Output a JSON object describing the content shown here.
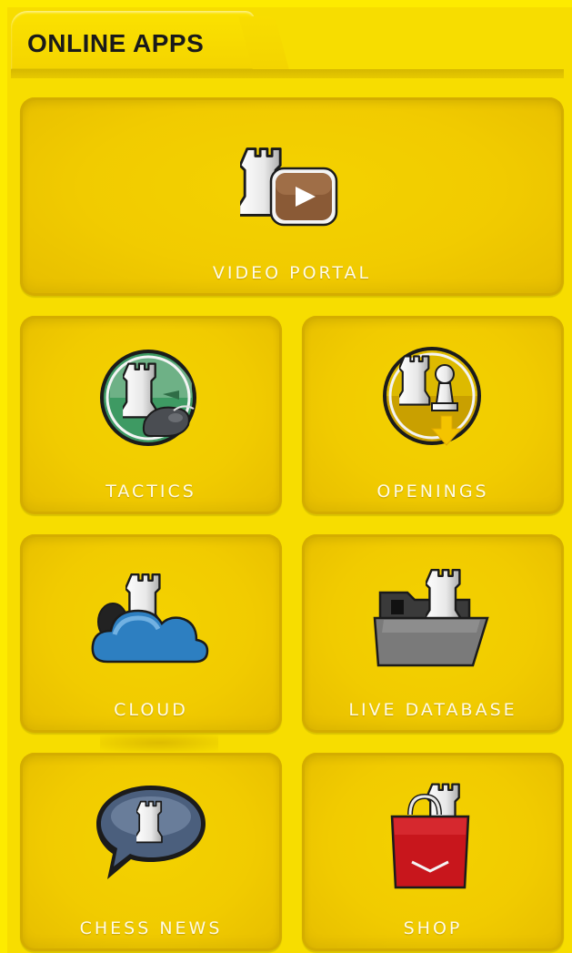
{
  "panel": {
    "title": "ONLINE APPS"
  },
  "tiles": {
    "video_portal": {
      "label": "VIDEO PORTAL",
      "icon": "rook-play-icon"
    },
    "tactics": {
      "label": "TACTICS",
      "icon": "rook-whistle-icon"
    },
    "openings": {
      "label": "OPENINGS",
      "icon": "rook-pawn-download-icon"
    },
    "cloud": {
      "label": "CLOUD",
      "icon": "rook-cloud-icon"
    },
    "live_database": {
      "label": "LIVE DATABASE",
      "icon": "rook-folder-icon"
    },
    "chess_news": {
      "label": "CHESS NEWS",
      "icon": "rook-speech-bubble-icon"
    },
    "shop": {
      "label": "SHOP",
      "icon": "rook-shopping-bag-icon"
    }
  },
  "colors": {
    "background": "#fdeb00",
    "tile": "#f1cb00",
    "label": "#fffbe5"
  }
}
